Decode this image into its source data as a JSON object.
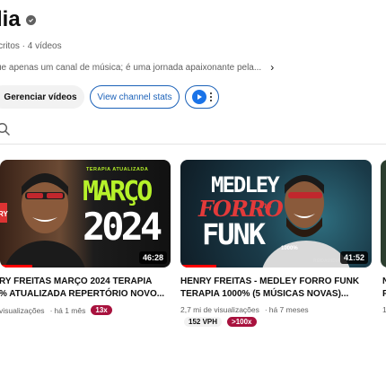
{
  "channel": {
    "name": "lia",
    "meta": "critos · 4 vídeos",
    "description": "ue apenas um canal de música; é uma jornada apaixonante pela..."
  },
  "actions": {
    "manage_videos": "Gerenciar vídeos",
    "channel_stats": "View channel stats"
  },
  "videos": [
    {
      "duration": "46:28",
      "title_line1": "RY FREITAS MARÇO 2024 TERAPIA",
      "title_line2": "% ATUALIZADA REPERTÓRIO NOVO...",
      "views": "visualizações",
      "age": "há 1 mês",
      "badge": "13x",
      "badge_color": "#a8123e",
      "thumb_text": {
        "tag": "TERAPIA ATUALIZADA",
        "month": "MARÇO",
        "year": "2024",
        "side": "RY"
      }
    },
    {
      "duration": "41:52",
      "title_line1": "HENRY FREITAS - MEDLEY FORRO FUNK",
      "title_line2": "TERAPIA 1000% (5 MÚSICAS NOVAS)...",
      "views": "2,7 mi de visualizações",
      "age": "há 7 meses",
      "vph": "152 VPH",
      "badge": ">100x",
      "badge_color": "#a8123e",
      "thumb_text": {
        "line1": "MEDLEY",
        "line2": "FORRO",
        "line3": "FUNK",
        "small": "1000%",
        "credit": "REIDAMIDIA.OP"
      }
    }
  ],
  "partial": {
    "title_a": "N",
    "title_b": "R",
    "meta": "1"
  },
  "colors": {
    "accent_blue": "#1c62b9",
    "thumb2_bg": "#1a2a36",
    "march_green": "#b6f22a"
  }
}
